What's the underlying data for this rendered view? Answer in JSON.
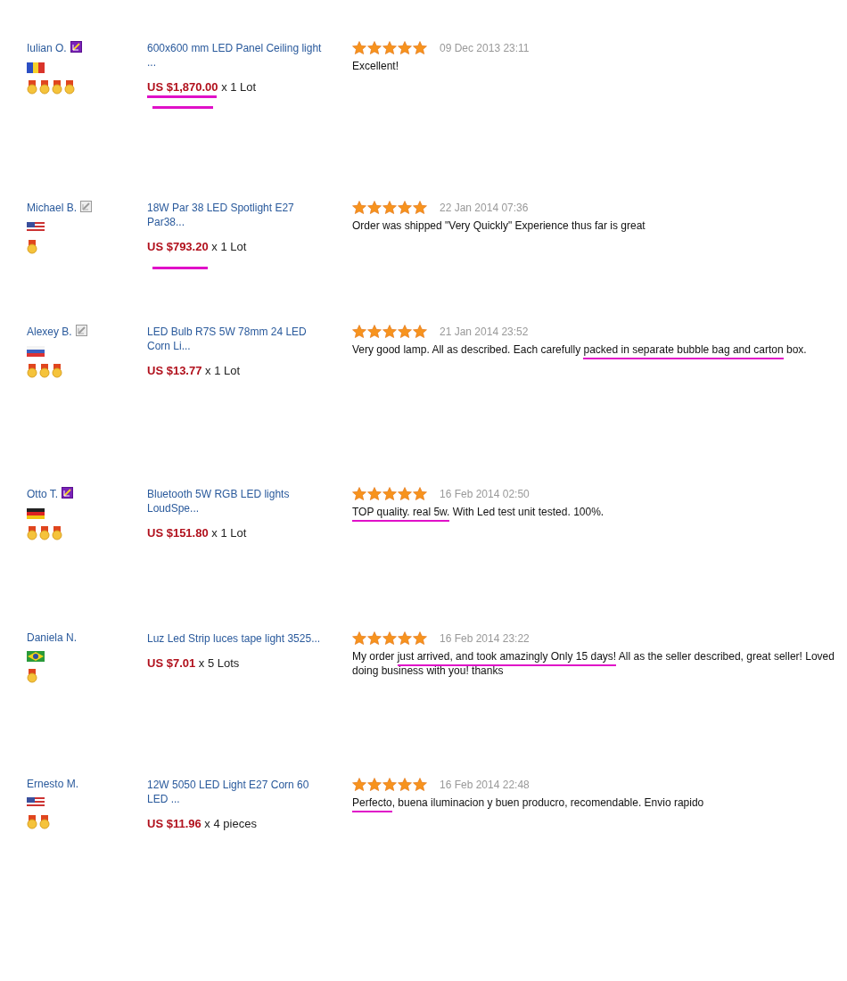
{
  "reviews": [
    {
      "buyer": "Iulian O.",
      "verified": true,
      "flag": {
        "kind": "ro"
      },
      "medals": [
        {
          "kind": "medal"
        },
        {
          "kind": "medal"
        },
        {
          "kind": "medal"
        },
        {
          "kind": "medal"
        }
      ],
      "product": "600x600 mm LED Panel Ceiling light ...",
      "price": "US $1,870.00",
      "quantity": "x 1 Lot",
      "price_marks": [
        {
          "kind": "underline"
        },
        {
          "kind": "underline"
        }
      ],
      "stars": 5,
      "date": "09 Dec 2013 23:11",
      "comment": [
        {
          "text": "Excellent!",
          "underlined": false
        }
      ]
    },
    {
      "buyer": "Michael B.",
      "verified": false,
      "flag": {
        "kind": "us"
      },
      "medals": [
        {
          "kind": "medal"
        }
      ],
      "product": "18W Par 38 LED Spotlight E27 Par38...",
      "price": "US $793.20",
      "quantity": "x 1 Lot",
      "price_marks": [
        {
          "kind": "underline-low"
        }
      ],
      "stars": 5,
      "date": "22 Jan 2014 07:36",
      "comment": [
        {
          "text": "Order was shipped \"Very Quickly\" Experience thus far is great",
          "underlined": false
        }
      ]
    },
    {
      "buyer": "Alexey B.",
      "verified": false,
      "flag": {
        "kind": "ru"
      },
      "medals": [
        {
          "kind": "medal"
        },
        {
          "kind": "medal"
        },
        {
          "kind": "medal"
        }
      ],
      "product": "LED Bulb R7S 5W 78mm 24 LED Corn Li...",
      "price": "US $13.77",
      "quantity": "x 1 Lot",
      "stars": 5,
      "date": "21 Jan 2014 23:52",
      "comment": [
        {
          "text": "Very good lamp. All as described. Each carefully ",
          "underlined": false
        },
        {
          "text": "packed in separate bubble bag and carton",
          "underlined": true
        },
        {
          "text": " box.",
          "underlined": false
        }
      ]
    },
    {
      "buyer": "Otto T.",
      "verified": true,
      "flag": {
        "kind": "de"
      },
      "medals": [
        {
          "kind": "medal"
        },
        {
          "kind": "medal"
        },
        {
          "kind": "medal"
        }
      ],
      "product": "Bluetooth 5W RGB LED lights LoudSpe...",
      "price": "US $151.80",
      "quantity": "x 1 Lot",
      "stars": 5,
      "date": "16 Feb 2014 02:50",
      "comment": [
        {
          "text": "TOP quality. real 5w.",
          "underlined": true
        },
        {
          "text": " With Led test unit tested. 100%.",
          "underlined": false
        }
      ]
    },
    {
      "buyer": "Daniela N.",
      "flag": {
        "kind": "br"
      },
      "medals": [
        {
          "kind": "medal"
        }
      ],
      "product": "Luz Led Strip luces tape light 3525...",
      "price": "US $7.01",
      "quantity": "x 5 Lots",
      "stars": 5,
      "date": "16 Feb 2014 23:22",
      "comment": [
        {
          "text": "My order ",
          "underlined": false
        },
        {
          "text": "just arrived, and took amazingly Only 15 days!",
          "underlined": true
        },
        {
          "text": " All as the seller described, great seller! Loved doing business with you! thanks",
          "underlined": false
        }
      ]
    },
    {
      "buyer": "Ernesto M.",
      "flag": {
        "kind": "us"
      },
      "medals": [
        {
          "kind": "medal"
        },
        {
          "kind": "medal"
        }
      ],
      "product": "12W 5050 LED Light E27 Corn 60 LED ...",
      "price": "US $11.96",
      "quantity": "x 4 pieces",
      "stars": 5,
      "date": "16 Feb 2014 22:48",
      "comment": [
        {
          "text": "Perfecto",
          "underlined": true
        },
        {
          "text": ", buena iluminacion y buen producro, recomendable. Envio rapido",
          "underlined": false
        }
      ]
    }
  ]
}
